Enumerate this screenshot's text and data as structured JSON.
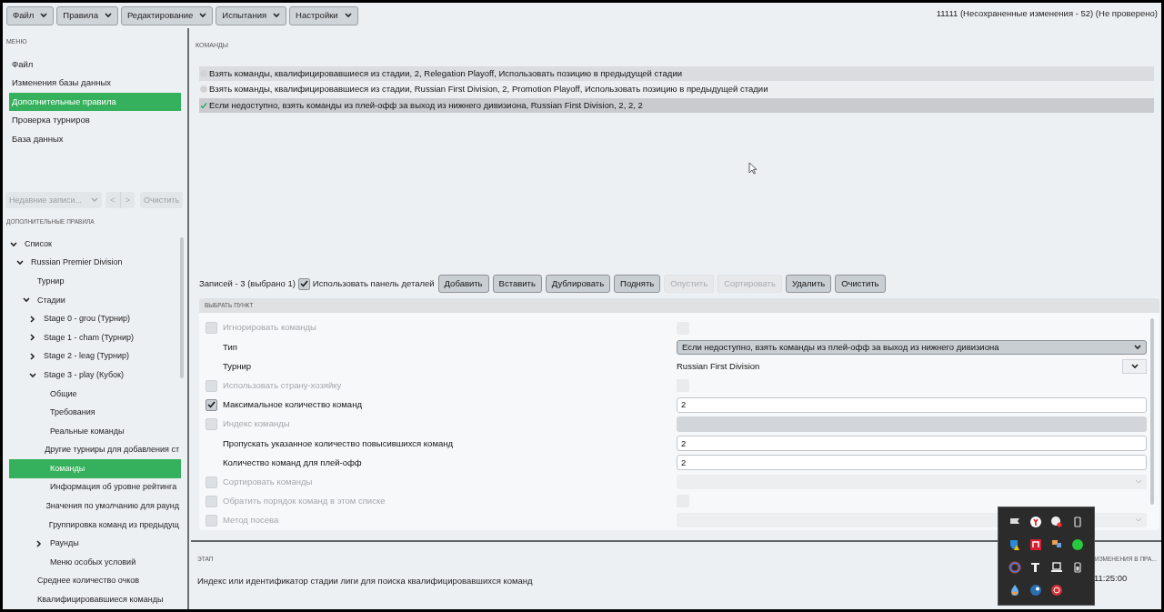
{
  "menubar": [
    {
      "label": "Файл"
    },
    {
      "label": "Правила"
    },
    {
      "label": "Редактирование"
    },
    {
      "label": "Испытания"
    },
    {
      "label": "Настройки"
    }
  ],
  "status": "11111 (Несохраненные изменения - 52) (Не проверено)",
  "sidebar": {
    "menu_title": "МЕНЮ",
    "items": [
      {
        "label": "Файл",
        "selected": false
      },
      {
        "label": "Изменения базы данных",
        "selected": false
      },
      {
        "label": "Дополнительные правила",
        "selected": true
      },
      {
        "label": "Проверка турниров",
        "selected": false
      },
      {
        "label": "База данных",
        "selected": false
      }
    ],
    "recent": {
      "placeholder": "Недавние записи...",
      "clear": "Очистить",
      "back": "<",
      "forward": ">"
    },
    "tree_title": "ДОПОЛНИТЕЛЬНЫЕ ПРАВИЛА",
    "tree": [
      {
        "label": "Список",
        "selected": false,
        "expanded": true,
        "children": [
          {
            "label": "Russian Premier Division",
            "selected": false,
            "expanded": true,
            "children": [
              {
                "label": "Турнир",
                "selected": false
              },
              {
                "label": "Стадии",
                "selected": false,
                "expanded": true,
                "children": [
                  {
                    "label": "Stage 0 - grou (Турнир)",
                    "selected": false,
                    "expanded": false
                  },
                  {
                    "label": "Stage 1 - cham (Турнир)",
                    "selected": false,
                    "expanded": false
                  },
                  {
                    "label": "Stage 2 - leag (Турнир)",
                    "selected": false,
                    "expanded": false
                  },
                  {
                    "label": "Stage 3 - play (Кубок)",
                    "selected": false,
                    "expanded": true,
                    "children": [
                      {
                        "label": "Общие",
                        "selected": false
                      },
                      {
                        "label": "Требования",
                        "selected": false
                      },
                      {
                        "label": "Реальные команды",
                        "selected": false
                      },
                      {
                        "label": "Другие турниры для добавления ст",
                        "selected": false
                      },
                      {
                        "label": "Команды",
                        "selected": true
                      },
                      {
                        "label": "Информация об уровне рейтинга",
                        "selected": false
                      },
                      {
                        "label": "Значения по умолчанию для раунд",
                        "selected": false
                      },
                      {
                        "label": "Группировка команд из предыдущ",
                        "selected": false
                      },
                      {
                        "label": "Раунды",
                        "selected": false,
                        "expanded": false
                      },
                      {
                        "label": "Меню особых условий",
                        "selected": false
                      }
                    ]
                  }
                ]
              },
              {
                "label": "Среднее количество очков",
                "selected": false
              },
              {
                "label": "Квалифицировавшиеся команды",
                "selected": false
              }
            ]
          }
        ]
      }
    ]
  },
  "teams": {
    "title": "КОМАНДЫ",
    "items": [
      {
        "label": "Взять команды, квалифицировавшиеся из стадии, 2, Relegation Playoff, Использовать позицию в предыдущей стадии",
        "selected": false
      },
      {
        "label": "Взять команды, квалифицировавшиеся из стадии, Russian First Division, 2, Promotion Playoff, Использовать позицию в предыдущей стадии",
        "selected": false
      },
      {
        "label": "Если недоступно, взять команды из плей-офф за выход из нижнего дивизиона, Russian First Division, 2, 2, 2",
        "selected": true
      }
    ]
  },
  "toolbar": {
    "count": "Записей - 3 (выбрано 1)",
    "details_panel": {
      "label": "Использовать панель деталей",
      "checked": true
    },
    "buttons": [
      {
        "label": "Добавить",
        "disabled": false
      },
      {
        "label": "Вставить",
        "disabled": false
      },
      {
        "label": "Дублировать",
        "disabled": false
      },
      {
        "label": "Поднять",
        "disabled": false
      },
      {
        "label": "Опустить",
        "disabled": true
      },
      {
        "label": "Сортировать",
        "disabled": true
      },
      {
        "label": "Удалить",
        "disabled": false
      },
      {
        "label": "Очистить",
        "disabled": false
      }
    ]
  },
  "details": {
    "title": "ВЫБРАТЬ ПУНКТ",
    "rows": [
      {
        "kind": "checkbox",
        "label": "Игнорировать команды",
        "checked": false,
        "disabled": true,
        "control": {
          "kind": "toggle",
          "checked": false
        }
      },
      {
        "kind": "plain",
        "label": "Тип",
        "disabled": false,
        "control": {
          "kind": "select",
          "value": "Если недоступно, взять команды из плей-офф за выход из нижнего дивизиона"
        }
      },
      {
        "kind": "plain",
        "label": "Турнир",
        "disabled": false,
        "control": {
          "kind": "combo",
          "value": "Russian First Division"
        }
      },
      {
        "kind": "checkbox",
        "label": "Использовать страну-хозяйку",
        "checked": false,
        "disabled": true,
        "control": {
          "kind": "toggle",
          "checked": false
        }
      },
      {
        "kind": "checkbox",
        "label": "Максимальное количество команд",
        "checked": true,
        "disabled": false,
        "control": {
          "kind": "input",
          "value": "2"
        }
      },
      {
        "kind": "checkbox",
        "label": "Индекс команды",
        "checked": false,
        "disabled": true,
        "control": {
          "kind": "input"
        }
      },
      {
        "kind": "plain",
        "label": "Пропускать указанное количество повысившихся команд",
        "disabled": false,
        "control": {
          "kind": "input",
          "value": "2"
        }
      },
      {
        "kind": "plain",
        "label": "Количество команд для плей-офф",
        "disabled": false,
        "control": {
          "kind": "input",
          "value": "2"
        }
      },
      {
        "kind": "checkbox",
        "label": "Сортировать команды",
        "checked": false,
        "disabled": true,
        "control": {
          "kind": "select"
        }
      },
      {
        "kind": "checkbox",
        "label": "Обратить порядок команд в этом списке",
        "checked": false,
        "disabled": true,
        "control": {
          "kind": "toggle",
          "checked": false
        }
      },
      {
        "kind": "checkbox",
        "label": "Метод посева",
        "checked": false,
        "disabled": true,
        "control": {
          "kind": "select"
        }
      }
    ]
  },
  "footer": {
    "title": "ЭТАП",
    "description": "Индекс или идентификатор стадии лиги для поиска квалифицировавшихся команд",
    "right_label": "ИЗМЕНЕНИЯ В ПРА...",
    "time": "11:25:00"
  }
}
